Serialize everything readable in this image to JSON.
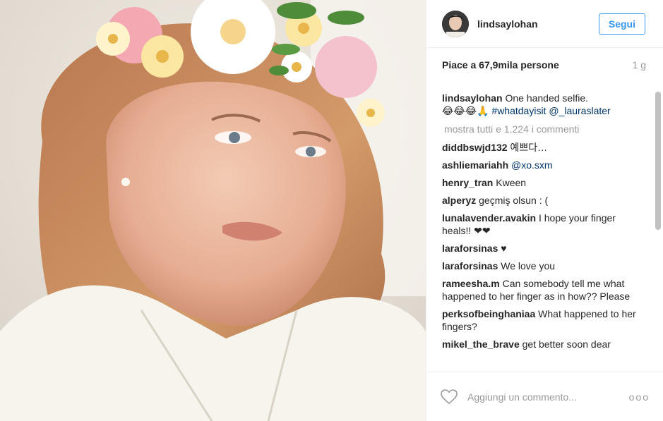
{
  "post": {
    "username": "lindsaylohan",
    "follow_label": "Segui",
    "likes": "Piace a 67,9mila persone",
    "time": "1 g"
  },
  "caption": {
    "user": "lindsaylohan",
    "text": "One handed selfie.",
    "emoji": "😂😂😂🙏",
    "hashtag": "#whatdayisit",
    "mention": "@_lauraslater"
  },
  "show_all_comments": "mostra tutti e 1.224 i commenti",
  "comments": [
    {
      "user": "diddbswjd132",
      "text": "예쁘다…"
    },
    {
      "user": "ashliemariahh",
      "text": "@xo.sxm"
    },
    {
      "user": "henry_tran",
      "text": "Kween"
    },
    {
      "user": "alperyz",
      "text": "geçmiş olsun : ("
    },
    {
      "user": "lunalavender.avakin",
      "text": "I hope your finger heals!! ❤❤"
    },
    {
      "user": "laraforsinas",
      "text": "♥"
    },
    {
      "user": "laraforsinas",
      "text": "We love you"
    },
    {
      "user": "rameesha.m",
      "text": "Can somebody tell me what happened to her finger as in how?? Please"
    },
    {
      "user": "perksofbeinghaniaa",
      "text": "What happened to her fingers?"
    },
    {
      "user": "mikel_the_brave",
      "text": "get better soon dear"
    }
  ],
  "footer": {
    "comment_placeholder": "Aggiungi un commento...",
    "more_options": "ooo",
    "heart_icon": "heart-outline-icon"
  },
  "colors": {
    "link": "#003569",
    "follow_blue": "#3897f0",
    "muted": "#999999"
  },
  "photo": {
    "description_icon": "selfie-photo-with-flower-crown"
  }
}
